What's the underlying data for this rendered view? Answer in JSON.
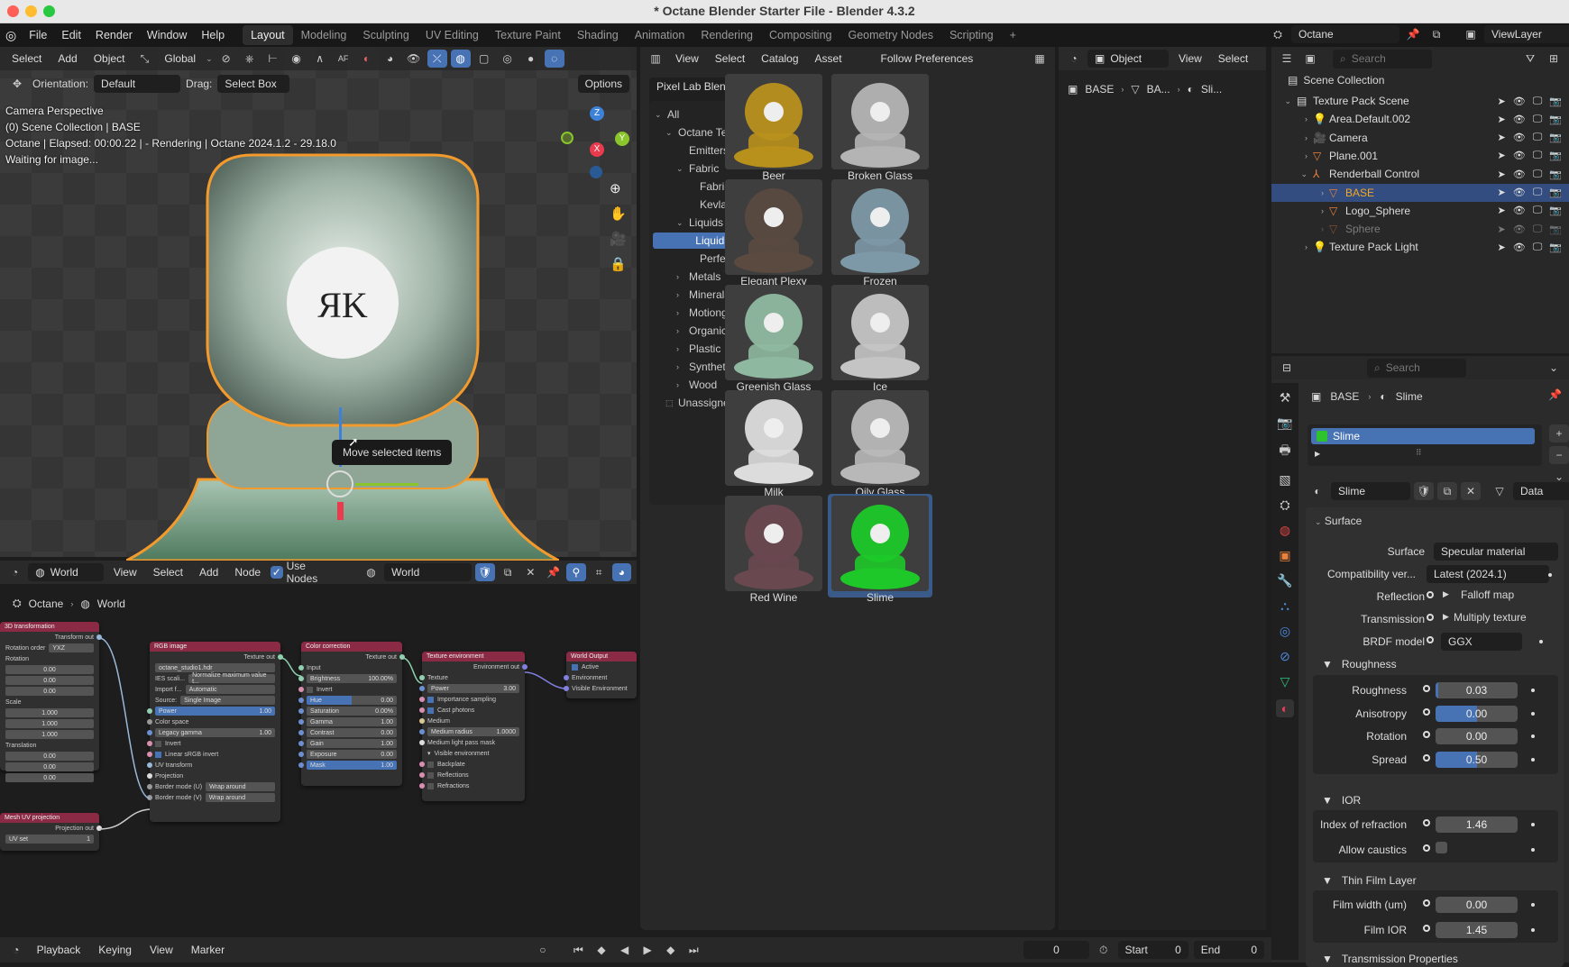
{
  "window": {
    "title": "* Octane Blender Starter File - Blender 4.3.2"
  },
  "menu": {
    "items": [
      "File",
      "Edit",
      "Render",
      "Window",
      "Help"
    ],
    "workspaces": [
      "Layout",
      "Modeling",
      "Sculpting",
      "UV Editing",
      "Texture Paint",
      "Shading",
      "Animation",
      "Rendering",
      "Compositing",
      "Geometry Nodes",
      "Scripting"
    ],
    "active_workspace": "Layout",
    "add_workspace": "+"
  },
  "top_right": {
    "scene": "Octane",
    "view_layer": "ViewLayer"
  },
  "viewport": {
    "header": {
      "select": "Select",
      "add": "Add",
      "object": "Object",
      "transform": "Global"
    },
    "tool_header": {
      "orientation_label": "Orientation:",
      "orientation_value": "Default",
      "drag_label": "Drag:",
      "drag_value": "Select Box",
      "options": "Options"
    },
    "overlay": [
      "Camera Perspective",
      "(0) Scene Collection | BASE",
      "Octane | Elapsed: 00:00.22 |  - Rendering | Octane 2024.1.2 - 29.18.0",
      "Waiting for image..."
    ],
    "tooltip": "Move selected items",
    "gizmo": {
      "z": "Z",
      "x": "X",
      "y": "Y"
    }
  },
  "node_editor": {
    "header": {
      "type": "World",
      "view": "View",
      "select": "Select",
      "add": "Add",
      "node": "Node",
      "use_nodes": "Use Nodes",
      "world": "World"
    },
    "breadcrumb": [
      "Octane",
      "World"
    ],
    "nodes": {
      "transform": {
        "title": "3D transformation",
        "out": "Transform out",
        "rot_order_label": "Rotation order",
        "rot_order": "YXZ",
        "rotation_label": "Rotation",
        "rotation": [
          "0.00",
          "0.00",
          "0.00"
        ],
        "scale_label": "Scale",
        "scale": [
          "1.000",
          "1.000",
          "1.000"
        ],
        "translation_label": "Translation",
        "translation": [
          "0.00",
          "0.00",
          "0.00"
        ]
      },
      "uvproj": {
        "title": "Mesh UV projection",
        "out": "Projection out",
        "uvset_label": "UV set",
        "uvset": "1"
      },
      "rgb": {
        "title": "RGB image",
        "out": "Texture out",
        "file": "octane_studio1.hdr",
        "ies_label": "IES scali...",
        "ies": "Normalize maximum value t...",
        "import_label": "Import f...",
        "import": "Automatic",
        "source_label": "Source:",
        "source": "Single Image",
        "power_label": "Power",
        "power": "1.00",
        "colorspace": "Color space",
        "legacy_label": "Legacy gamma",
        "legacy": "1.00",
        "invert": "Invert",
        "linear": "Linear sRGB invert",
        "uvt": "UV transform",
        "projection": "Projection",
        "bu_label": "Border mode (U)",
        "bu": "Wrap around",
        "bv_label": "Border mode (V)",
        "bv": "Wrap around"
      },
      "cc": {
        "title": "Color correction",
        "out": "Texture out",
        "input": "Input",
        "rows": [
          [
            "Brightness",
            "100.00%"
          ],
          [
            "Hue",
            "0.00"
          ],
          [
            "Saturation",
            "0.00%"
          ],
          [
            "Gamma",
            "1.00"
          ],
          [
            "Contrast",
            "0.00"
          ],
          [
            "Gain",
            "1.00"
          ],
          [
            "Exposure",
            "0.00"
          ],
          [
            "Mask",
            "1.00"
          ]
        ],
        "invert": "Invert"
      },
      "texenv": {
        "title": "Texture environment",
        "out": "Environment out",
        "texture": "Texture",
        "power_label": "Power",
        "power": "3.00",
        "importance": "Importance sampling",
        "cast": "Cast photons",
        "medium": "Medium",
        "mradius_label": "Medium radius",
        "mradius": "1.0000",
        "mlpm": "Medium light pass mask",
        "visenv": "Visible environment",
        "backplate": "Backplate",
        "reflections": "Reflections",
        "refractions": "Refractions"
      },
      "wout": {
        "title": "World Output",
        "active": "Active",
        "env": "Environment",
        "visenv": "Visible Environment"
      }
    }
  },
  "asset_browser": {
    "header": {
      "view": "View",
      "select": "Select",
      "catalog": "Catalog",
      "asset": "Asset",
      "import": "Follow Preferences"
    },
    "library": "Pixel Lab Blender ...",
    "tree": [
      {
        "label": "All",
        "level": 0,
        "state": "open"
      },
      {
        "label": "Octane Texture P...",
        "level": 1,
        "state": "open"
      },
      {
        "label": "Emitters",
        "level": 2,
        "state": "leaf"
      },
      {
        "label": "Fabric",
        "level": 2,
        "state": "open"
      },
      {
        "label": "Fabric",
        "level": 3,
        "state": "leaf"
      },
      {
        "label": "Kevlar MIX",
        "level": 3,
        "state": "leaf"
      },
      {
        "label": "Liquids & Glas...",
        "level": 2,
        "state": "open"
      },
      {
        "label": "Liquids & Gl...",
        "level": 3,
        "state": "selected"
      },
      {
        "label": "Perfect Ple...",
        "level": 3,
        "state": "leaf"
      },
      {
        "label": "Metals",
        "level": 2,
        "state": "closed"
      },
      {
        "label": "Minerals",
        "level": 2,
        "state": "closed"
      },
      {
        "label": "Motiongraphic",
        "level": 2,
        "state": "closed"
      },
      {
        "label": "Organic",
        "level": 2,
        "state": "closed"
      },
      {
        "label": "Plastic",
        "level": 2,
        "state": "closed"
      },
      {
        "label": "Synthetic",
        "level": 2,
        "state": "closed"
      },
      {
        "label": "Wood",
        "level": 2,
        "state": "closed"
      },
      {
        "label": "Unassigned",
        "level": 1,
        "state": "unassigned"
      }
    ],
    "assets": [
      {
        "name": "Beer",
        "color": "#b8901c"
      },
      {
        "name": "Broken Glass",
        "color": "#b4b4b4"
      },
      {
        "name": "Elegant Plexy",
        "color": "#5a4a40"
      },
      {
        "name": "Frozen",
        "color": "#7d98a6"
      },
      {
        "name": "Greenish Glass",
        "color": "#8fb8a0"
      },
      {
        "name": "Ice",
        "color": "#c4c4c4"
      },
      {
        "name": "Milk",
        "color": "#dcdcdc"
      },
      {
        "name": "Oily Glass",
        "color": "#b8b8b8"
      },
      {
        "name": "Red Wine",
        "color": "#6a4850"
      },
      {
        "name": "Slime",
        "color": "#1ec829",
        "selected": true
      }
    ]
  },
  "center_right": {
    "editor_mode": "Object",
    "view": "View",
    "select": "Select",
    "breadcrumb": [
      "BASE",
      "BA...",
      "Sli..."
    ]
  },
  "outliner": {
    "search_placeholder": "Search",
    "root": "Scene Collection",
    "items": [
      {
        "label": "Texture Pack Scene",
        "level": 0,
        "icon": "collection",
        "expanded": true
      },
      {
        "label": "Area.Default.002",
        "level": 1,
        "icon": "light"
      },
      {
        "label": "Camera",
        "level": 1,
        "icon": "camera"
      },
      {
        "label": "Plane.001",
        "level": 1,
        "icon": "mesh"
      },
      {
        "label": "Renderball Control",
        "level": 1,
        "icon": "empty",
        "expanded": true
      },
      {
        "label": "BASE",
        "level": 2,
        "icon": "mesh",
        "selected": true
      },
      {
        "label": "Logo_Sphere",
        "level": 2,
        "icon": "mesh"
      },
      {
        "label": "Sphere",
        "level": 2,
        "icon": "mesh",
        "hidden": true
      },
      {
        "label": "Texture Pack Light",
        "level": 1,
        "icon": "light"
      }
    ]
  },
  "properties": {
    "search_placeholder": "Search",
    "breadcrumb": [
      "BASE",
      "Slime"
    ],
    "slot": "Slime",
    "material": "Slime",
    "link": "Data",
    "surface_panel": "Surface",
    "rows": {
      "surface": {
        "label": "Surface",
        "value": "Specular material"
      },
      "compat": {
        "label": "Compatibility ver...",
        "value": "Latest (2024.1)"
      },
      "reflection": {
        "label": "Reflection",
        "value": "Falloff map"
      },
      "transmission": {
        "label": "Transmission",
        "value": "Multiply texture"
      },
      "brdf": {
        "label": "BRDF model",
        "value": "GGX"
      }
    },
    "roughness_section": "Roughness",
    "roughness": [
      {
        "label": "Roughness",
        "value": "0.03",
        "fraction": 0.03
      },
      {
        "label": "Anisotropy",
        "value": "0.00",
        "fraction": 0.5
      },
      {
        "label": "Rotation",
        "value": "0.00",
        "fraction": 0
      },
      {
        "label": "Spread",
        "value": "0.50",
        "fraction": 0.5
      }
    ],
    "ior_section": "IOR",
    "ior": {
      "label": "Index of refraction",
      "value": "1.46"
    },
    "caustics": {
      "label": "Allow caustics",
      "checked": false
    },
    "film_section": "Thin Film Layer",
    "film": [
      {
        "label": "Film width (um)",
        "value": "0.00"
      },
      {
        "label": "Film IOR",
        "value": "1.45"
      }
    ],
    "next_section": "Transmission Properties"
  },
  "timeline": {
    "playback": "Playback",
    "keying": "Keying",
    "view": "View",
    "marker": "Marker",
    "frame": "0",
    "start_label": "Start",
    "start": "0",
    "end_label": "End",
    "end": "0"
  }
}
